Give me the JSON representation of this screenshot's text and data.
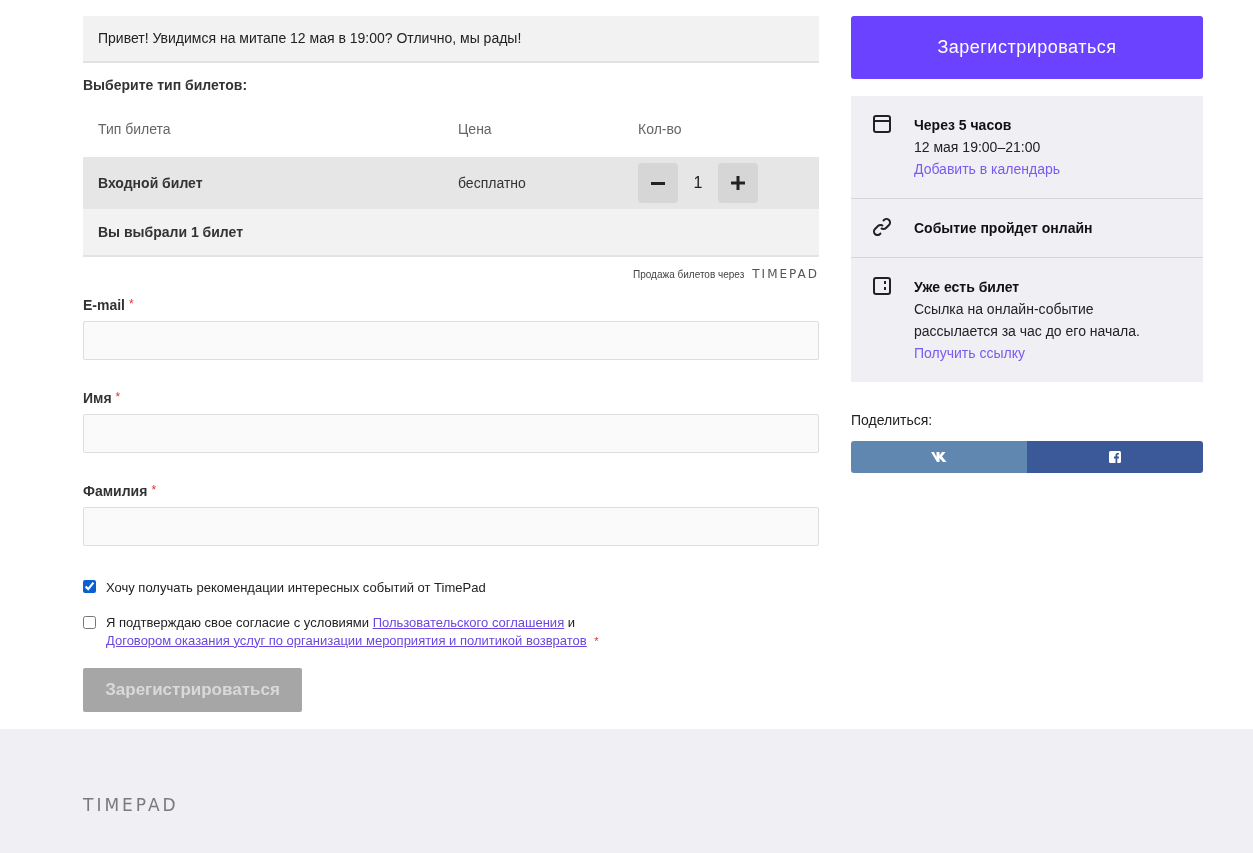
{
  "greeting": "Привет! Увидимся на митапе 12 мая в 19:00? Отлично, мы рады!",
  "tickets": {
    "heading": "Выберите тип билетов:",
    "columns": [
      "Тип билета",
      "Цена",
      "Кол-во"
    ],
    "rows": [
      {
        "name": "Входной билет",
        "price": "бесплатно",
        "quantity": "1"
      }
    ],
    "summary": "Вы выбрали 1 билет",
    "powered_by": "Продажа билетов через",
    "powered_logo": "TIMEPAD"
  },
  "fields": [
    {
      "label": "E-mail",
      "required_mark": "*"
    },
    {
      "label": "Имя",
      "required_mark": "*"
    },
    {
      "label": "Фамилия",
      "required_mark": "*"
    }
  ],
  "checkboxes": [
    {
      "kind": "plain",
      "text": "Хочу получать рекомендации интересных событий от TimePad",
      "checked": true
    },
    {
      "kind": "consent",
      "text": "Я подтверждаю свое согласие с условиями",
      "link_1": "Пользовательского соглашения",
      "joiner": "и",
      "link_2": "Договором оказания услуг по организации мероприятия и политикой возвратов",
      "required_mark": "*",
      "checked": false
    }
  ],
  "submit": {
    "label": "Зарегистрироваться",
    "disabled": true
  },
  "sidebar": {
    "register_button": "Зарегистрироваться",
    "info": [
      {
        "kind": "calendar",
        "title": "Через 5 часов",
        "lines": [
          "12 мая 19:00–21:00"
        ],
        "link": "Добавить в календарь"
      },
      {
        "kind": "link",
        "title": "Событие пройдет онлайн"
      },
      {
        "kind": "ticket",
        "title": "Уже есть билет",
        "lines": [
          "Ссылка на онлайн-событие",
          "рассылается за час до его начала."
        ],
        "link": "Получить ссылку"
      }
    ],
    "share_label": "Поделиться:",
    "share": [
      {
        "kind": "vk",
        "color": "#5f87b0"
      },
      {
        "kind": "facebook",
        "color": "#3b5998"
      }
    ]
  },
  "footer": {
    "logo": "TIMEPAD"
  }
}
